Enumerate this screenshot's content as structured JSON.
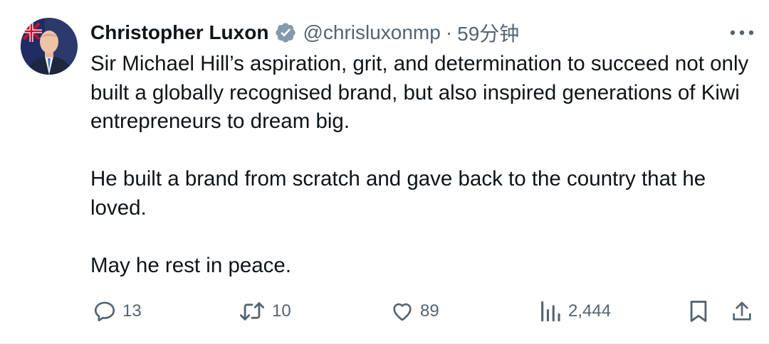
{
  "tweet": {
    "author_name": "Christopher Luxon",
    "handle": "@chrisluxonmp",
    "separator": "·",
    "timestamp": "59分钟",
    "verified_color": "#829aab",
    "paragraphs": [
      "Sir Michael Hill’s aspiration, grit, and determination to succeed not only built a globally recognised brand, but also inspired generations of Kiwi entrepreneurs to dream big.",
      "He built a brand from scratch and gave back to the country that he loved.",
      "May he rest in peace."
    ]
  },
  "actions": {
    "replies": "13",
    "reposts": "10",
    "likes": "89",
    "views": "2,444"
  },
  "icons": [
    "verified-badge-icon",
    "more-icon",
    "reply-icon",
    "repost-icon",
    "like-icon",
    "views-icon",
    "bookmark-icon",
    "share-icon"
  ],
  "colors": {
    "text": "#0f1419",
    "secondary": "#536471"
  }
}
